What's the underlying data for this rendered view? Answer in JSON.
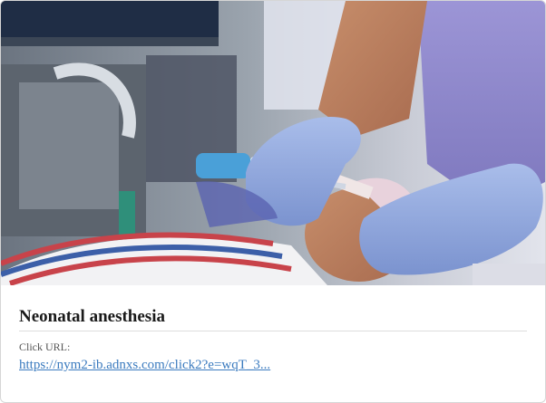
{
  "card": {
    "title": "Neonatal anesthesia",
    "url_label": "Click URL:",
    "url_text": "https://nym2-ib.adnxs.com/click2?e=wqT_3..."
  },
  "colors": {
    "link": "#3b7bbf",
    "glove": "#8ea6da",
    "scrubs": "#8c86c9",
    "blanket_stripe": "#c8434a"
  }
}
